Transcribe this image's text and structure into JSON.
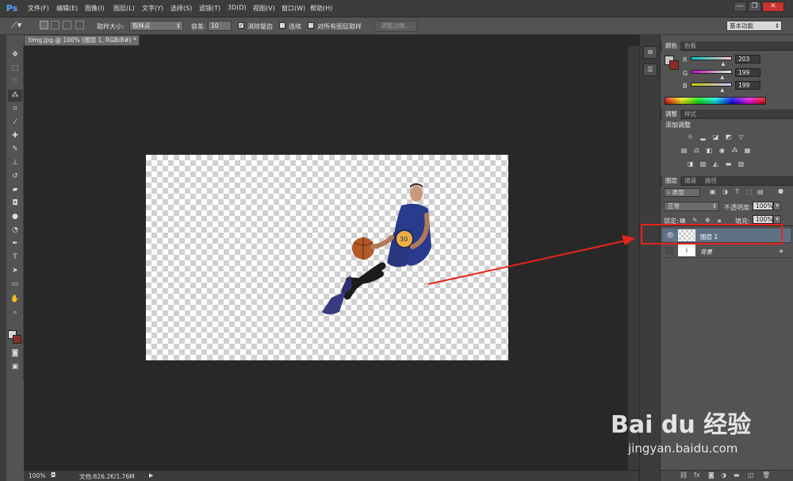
{
  "app": {
    "logo": "Ps",
    "menu": [
      "文件(F)",
      "编辑(E)",
      "图像(I)",
      "图层(L)",
      "文字(Y)",
      "选择(S)",
      "滤镜(T)",
      "3D(D)",
      "视图(V)",
      "窗口(W)",
      "帮助(H)"
    ],
    "window_controls": [
      "—",
      "❐",
      "✕"
    ]
  },
  "options": {
    "sample_size_label": "取样大小:",
    "sample_size_value": "取样点",
    "tolerance_label": "容差:",
    "tolerance_value": "10",
    "antialias_label": "消除锯齿",
    "contiguous_label": "连续",
    "all_layers_label": "对所有图层取样",
    "refine_edge_button": "调整边缘...",
    "workspace": "基本功能"
  },
  "document": {
    "tab_title": "timg.jpg @ 100% (图层 1, RGB/8#) *",
    "zoom": "100%",
    "doc_info": "文档:826.2K/1.76M"
  },
  "color_panel": {
    "tabs": [
      "颜色",
      "色板"
    ],
    "channels": [
      {
        "label": "R",
        "value": "203",
        "level": 0.8
      },
      {
        "label": "G",
        "value": "199",
        "level": 0.78
      },
      {
        "label": "B",
        "value": "199",
        "level": 0.78
      }
    ]
  },
  "adjustments_panel": {
    "tabs": [
      "调整",
      "样式"
    ],
    "title": "添加调整"
  },
  "layers_panel": {
    "tabs": [
      "图层",
      "通道",
      "路径"
    ],
    "filter_kind": "类型",
    "blend_mode": "正常",
    "opacity_label": "不透明度:",
    "opacity_value": "100%",
    "lock_label": "锁定:",
    "fill_label": "填充:",
    "fill_value": "100%",
    "layers": [
      {
        "name": "图层 1"
      },
      {
        "name": "背景"
      }
    ]
  },
  "watermark": {
    "brand": "Bai du 经验",
    "url": "jingyan.baidu.com"
  },
  "colors": {
    "annotation_red": "#e8241c",
    "selected_layer": "#5e7185"
  }
}
